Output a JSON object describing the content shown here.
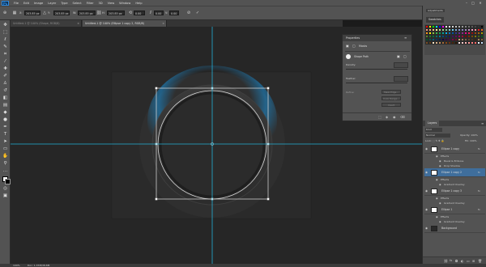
{
  "app": {
    "logo": "Ps"
  },
  "menu": [
    "File",
    "Edit",
    "Image",
    "Layer",
    "Type",
    "Select",
    "Filter",
    "3D",
    "View",
    "Window",
    "Help"
  ],
  "window_controls": {
    "minimize": "–",
    "maximize": "□",
    "close": "✕"
  },
  "options_bar": {
    "width_label": "W:",
    "width_value": "203.85 px",
    "height_label": "H:",
    "height_value": "203.85 px",
    "x_label": "X:",
    "x_value": "0.00",
    "y_label": "Y:",
    "y_value": "0.00",
    "angle_value": "0.00",
    "commit_icon": "✓",
    "cancel_icon": "⊘"
  },
  "tabs": [
    {
      "label": "Untitled-1 @ 100% (Shape, RGB/8)",
      "active": false
    },
    {
      "label": "Untitled-1 @ 100% (Ellipse 1 copy 2, RGB/8)",
      "active": true
    }
  ],
  "properties": {
    "title": "Properties",
    "mode_label": "Masks",
    "shape_path_label": "Shape Path",
    "density_label": "Density:",
    "feather_label": "Feather:",
    "refine_label": "Refine:",
    "buttons": [
      "Mask Edge...",
      "Color Range...",
      "Invert"
    ]
  },
  "swatches_panel": {
    "tab_label": "Swatches",
    "other_tab": "Adjustments"
  },
  "swatch_colors": [
    "#ff0000",
    "#ffff00",
    "#00ff00",
    "#00ffff",
    "#0000ff",
    "#ff00ff",
    "#ffffff",
    "#ebebeb",
    "#d6d6d6",
    "#c2c2c2",
    "#adadad",
    "#999999",
    "#858585",
    "#707070",
    "#5c5c5c",
    "#474747",
    "#333333",
    "#000000",
    "#f7977a",
    "#f9ad81",
    "#fdc68a",
    "#fff79a",
    "#c4df9b",
    "#a2d39c",
    "#82ca9d",
    "#7bcdc8",
    "#6ecff6",
    "#7ea7d8",
    "#8493ca",
    "#8882be",
    "#a187be",
    "#bc8dbf",
    "#f49ac2",
    "#f6989d",
    "#ee1d24",
    "#f26522",
    "#f7941d",
    "#fff200",
    "#8dc73f",
    "#39b54a",
    "#00a651",
    "#00a99d",
    "#00aeef",
    "#0072bc",
    "#0054a6",
    "#2e3192",
    "#662d91",
    "#92278f",
    "#ec008c",
    "#ed145b",
    "#9e0b0f",
    "#a0410d",
    "#a3620a",
    "#aba000",
    "#598527",
    "#1a7b30",
    "#007236",
    "#00746b",
    "#0076a3",
    "#004a80",
    "#003471",
    "#1b1464",
    "#440e62",
    "#630460",
    "#9e005d",
    "#9e0039",
    "#790000",
    "#7b2e00",
    "#7d4900",
    "#827b00",
    "#406618",
    "#005e20",
    "#005826",
    "#005952",
    "#005b7f",
    "#003663",
    "#002157",
    "#0d004c",
    "#32004b",
    "#4b0049",
    "#7b0046",
    "#7a0026",
    "#c69c6d",
    "#9c7b5a",
    "#7b5f44",
    "#5f4631",
    "#483322",
    "#372515",
    "#a67c52",
    "#8c6239",
    "#754c24",
    "#603913",
    "#f5e6c8",
    "#d9b38c",
    "#bf8f60",
    "#a56b3a",
    "#8b4513",
    "#6b3410",
    "#4a2409",
    "#2d1604",
    "#ffe5e5",
    "#ffcccc",
    "#ffb3b3",
    "#ff9999",
    "#ff8080",
    "#ff6666",
    "#e5f2ff",
    "#cce5ff"
  ],
  "layers": {
    "tab_label": "Layers",
    "filter_label": "Kind",
    "blend_mode": "Normal",
    "opacity_label": "Opacity: 100%",
    "fill_label": "Fill: 100%",
    "rows": [
      {
        "type": "layer",
        "name": "Ellipse 1 copy",
        "selected": false
      },
      {
        "type": "fx",
        "name": "Effects"
      },
      {
        "type": "fx",
        "name": "Bevel & Emboss"
      },
      {
        "type": "fx",
        "name": "Drop Shadow"
      },
      {
        "type": "layer",
        "name": "Ellipse 1 copy 2",
        "selected": true
      },
      {
        "type": "fx",
        "name": "Effects"
      },
      {
        "type": "fx",
        "name": "Gradient Overlay"
      },
      {
        "type": "layer",
        "name": "Ellipse 1 copy 3",
        "selected": false
      },
      {
        "type": "fx",
        "name": "Effects"
      },
      {
        "type": "fx",
        "name": "Gradient Overlay"
      },
      {
        "type": "layer",
        "name": "Ellipse 1",
        "selected": false
      },
      {
        "type": "fx",
        "name": "Effects"
      },
      {
        "type": "fx",
        "name": "Gradient Overlay"
      },
      {
        "type": "layer",
        "name": "Background",
        "selected": false
      }
    ],
    "footer_icons": [
      "link-icon",
      "fx-icon",
      "mask-icon",
      "adjustment-icon",
      "folder-icon",
      "new-layer-icon",
      "trash-icon"
    ]
  },
  "status": {
    "zoom": "100%",
    "doc": "Doc: 1.37M/38.8M"
  },
  "colors": {
    "accent": "#3f6e9c",
    "guide": "#23b0d6",
    "glow": "#1a8fd6"
  }
}
